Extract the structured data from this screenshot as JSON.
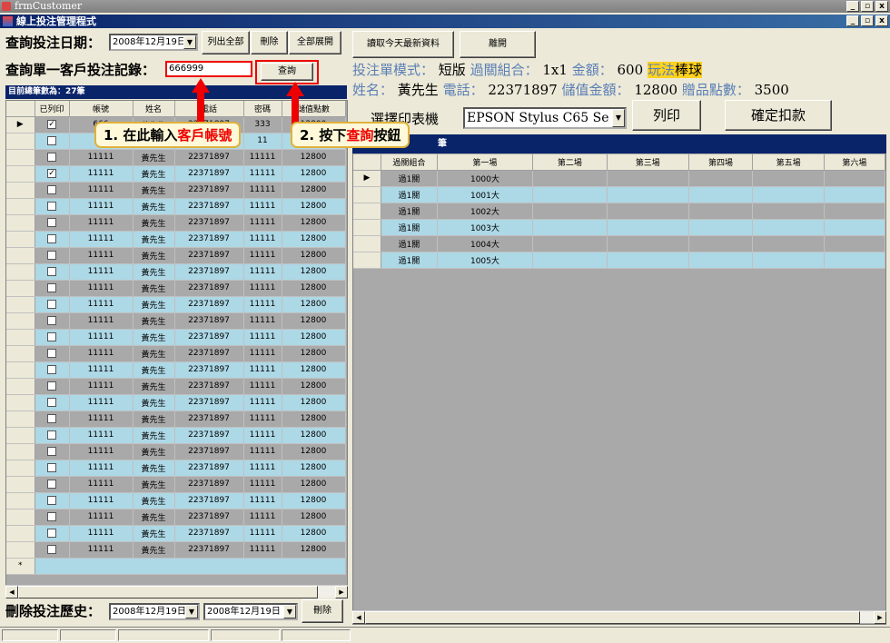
{
  "window": {
    "outer_title": "frmCustomer",
    "inner_title": "線上投注管理程式",
    "min": "_",
    "max": "ថ",
    "close": "x"
  },
  "top": {
    "date_label": "查詢投注日期：",
    "date_value": "2008年12月19日",
    "list_all": "列出全部",
    "delete": "刪除",
    "expand_all": "全部展開",
    "load_today": "讀取今天最新資料",
    "leave": "離開"
  },
  "search": {
    "label": "查詢單一客戶投注記錄：",
    "value": "666999",
    "query_button": "查詢"
  },
  "summary": {
    "mode_label": "投注單模式：",
    "mode_value": "短版",
    "combo_label": "過關組合：",
    "combo_value": "1x1",
    "amount_label": "金額：",
    "amount_value": "600",
    "play_label": "玩法",
    "play_value": "棒球",
    "name_label": "姓名：",
    "name_value": "黃先生",
    "phone_label": "電話：",
    "phone_value": "22371897",
    "balance_label": "儲值金額：",
    "balance_value": "12800",
    "bonus_label": "贈品點數：",
    "bonus_value": "3500"
  },
  "printer": {
    "label": "選擇印表機",
    "value": "EPSON Stylus C65 Se",
    "print_button": "列印",
    "confirm_button": "確定扣款"
  },
  "callouts": {
    "c1_prefix": "1. 在此輸入",
    "c1_red": "客戶帳號",
    "c2_prefix": "2. 按下",
    "c2_red": "查詢",
    "c2_suffix": "按鈕"
  },
  "left_grid": {
    "count_text": "目前總筆數為：27筆",
    "columns": [
      "已列印",
      "帳號",
      "姓名",
      "電話",
      "密碼",
      "儲值點數"
    ],
    "first_row": {
      "account": "666",
      "password": "333"
    },
    "second_row": {
      "account": "11",
      "password": "11"
    },
    "row_account": "11111",
    "row_name": "黃先生",
    "row_phone": "22371897",
    "row_password": "11111",
    "row_points": "12800",
    "new_row_marker": "*"
  },
  "right_grid": {
    "header_suffix": "筆",
    "columns": [
      "過關組合",
      "第一場",
      "第二場",
      "第三場",
      "第四場",
      "第五場",
      "第六場"
    ],
    "rows": [
      {
        "combo": "過1關",
        "first": "1000大"
      },
      {
        "combo": "過1關",
        "first": "1001大"
      },
      {
        "combo": "過1關",
        "first": "1002大"
      },
      {
        "combo": "過1關",
        "first": "1003大"
      },
      {
        "combo": "過1關",
        "first": "1004大"
      },
      {
        "combo": "過1關",
        "first": "1005大"
      }
    ]
  },
  "bottom": {
    "history_label": "刪除投注歷史：",
    "from_date": "2008年12月19日",
    "to_date": "2008年12月19日",
    "delete_button": "刪除"
  }
}
